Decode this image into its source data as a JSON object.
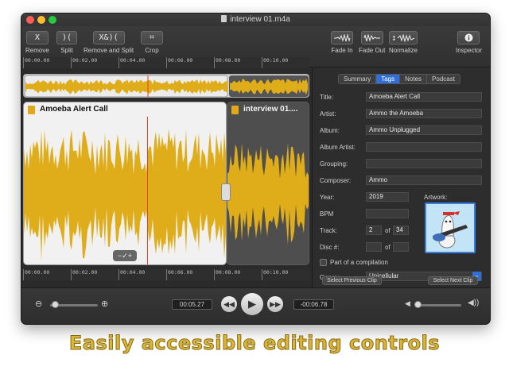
{
  "window": {
    "title": "interview 01.m4a"
  },
  "toolbar": {
    "left_tools": [
      {
        "label": "Remove",
        "glyph": "X"
      },
      {
        "label": "Split",
        "glyph": ")("
      },
      {
        "label": "Remove and Split",
        "glyph": "X&)("
      },
      {
        "label": "Crop",
        "glyph": "⌗"
      }
    ],
    "right_tools": [
      {
        "label": "Fade In"
      },
      {
        "label": "Fade Out"
      },
      {
        "label": "Normalize"
      },
      {
        "label": "Inspector"
      }
    ]
  },
  "ruler": {
    "ticks": [
      "00:00.00",
      "00:02.00",
      "00:04.00",
      "00:06.00",
      "00:08.00",
      "00:10.00"
    ]
  },
  "clips": {
    "main_title": "Amoeba Alert Call",
    "secondary_title": "interview 01...."
  },
  "inspector": {
    "tabs": [
      "Summary",
      "Tags",
      "Notes",
      "Podcast"
    ],
    "active_tab": "Tags",
    "fields": {
      "title_label": "Title:",
      "title_value": "Amoeba Alert Call",
      "artist_label": "Artist:",
      "artist_value": "Ammo the Amoeba",
      "album_label": "Album:",
      "album_value": "Ammo Unplugged",
      "album_artist_label": "Album Artist:",
      "album_artist_value": "",
      "grouping_label": "Grouping:",
      "grouping_value": "",
      "composer_label": "Composer:",
      "composer_value": "Ammo",
      "year_label": "Year:",
      "year_value": "2019",
      "bpm_label": "BPM",
      "bpm_value": "",
      "track_label": "Track:",
      "track_value": "2",
      "track_of_label": "of",
      "track_total": "34",
      "disc_label": "Disc #:",
      "disc_value": "",
      "disc_of_label": "of",
      "disc_total": "",
      "artwork_label": "Artwork:",
      "compilation_label": "Part of a compilation",
      "genre_label": "Genre:",
      "genre_value": "Unicellular"
    },
    "prev_clip": "Select Previous Clip",
    "next_clip": "Select Next Clip"
  },
  "transport": {
    "current_time": "00:05.27",
    "remaining_time": "-00:06.78",
    "zoom_level": 0.1,
    "volume_level": 0.05
  },
  "tagline": "Easily accessible editing controls",
  "colors": {
    "waveform": "#e0ad1a",
    "accent": "#2f6fd6",
    "playhead": "#e8402a",
    "tagline": "#d9b53a"
  }
}
